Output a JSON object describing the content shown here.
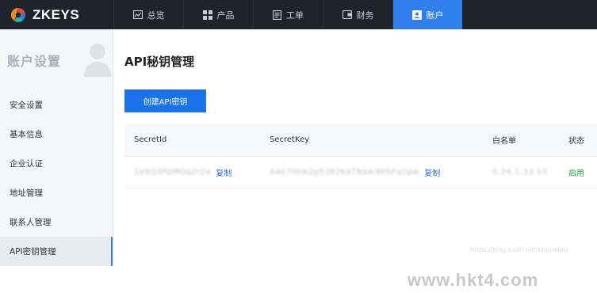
{
  "brand": {
    "name": "ZKEYS",
    "colors": {
      "orange": "#f08a24",
      "red": "#e8453c",
      "teal": "#2bb7a6",
      "blue": "#3a7bd5"
    }
  },
  "nav": {
    "items": [
      {
        "label": "总览",
        "icon": "dashboard-icon"
      },
      {
        "label": "产品",
        "icon": "grid-icon"
      },
      {
        "label": "工单",
        "icon": "ticket-icon"
      },
      {
        "label": "财务",
        "icon": "wallet-icon"
      },
      {
        "label": "账户",
        "icon": "account-icon",
        "active": true
      }
    ],
    "active_color": "#2f80ed",
    "background": "#1f232b"
  },
  "sidebar": {
    "title": "账户设置",
    "items": [
      {
        "label": "安全设置"
      },
      {
        "label": "基本信息"
      },
      {
        "label": "企业认证"
      },
      {
        "label": "地址管理"
      },
      {
        "label": "联系人管理"
      },
      {
        "label": "API密钥管理",
        "active": true
      }
    ]
  },
  "main": {
    "title": "API秘钥管理",
    "create_button": "创建API密钥",
    "table": {
      "headers": [
        "SecretId",
        "SecretKey",
        "白名单",
        "状态"
      ],
      "rows": [
        {
          "secret_id": "1e9Q3fQMGq2r2e",
          "secret_id_copy": "复制",
          "secret_key": "A4e7Hnk2p5382k4T9aw3H5Fq2pw",
          "secret_key_copy": "复制",
          "whitelist": "0.24.1.33.15",
          "status": "启用"
        }
      ]
    }
  },
  "watermarks": {
    "csdn": "https://blog.csdn.net/khonebro",
    "site": "www.hkt4.com"
  }
}
